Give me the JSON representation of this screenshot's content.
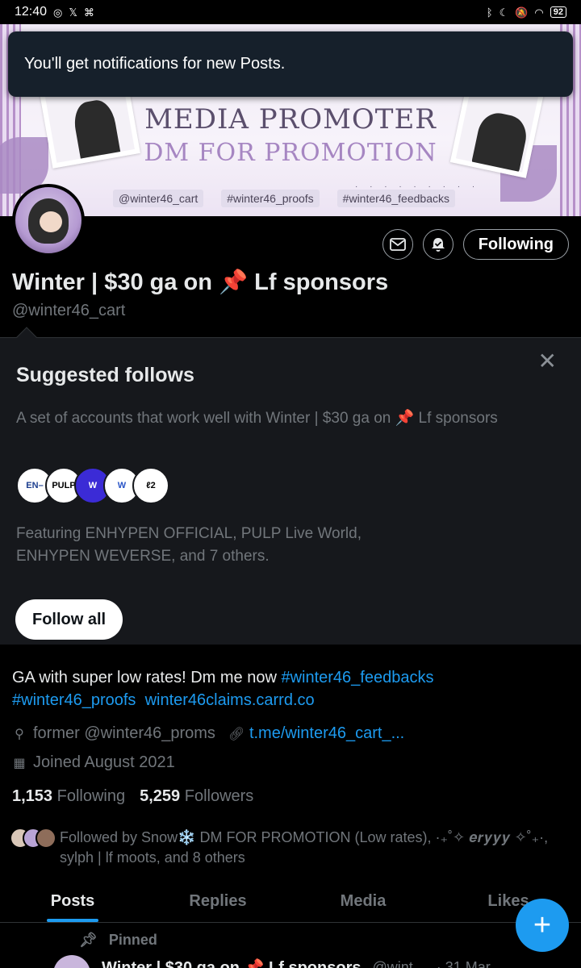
{
  "status_bar": {
    "time": "12:40",
    "battery": "92"
  },
  "toast": {
    "message": "You'll get notifications for new Posts."
  },
  "banner": {
    "line1": "MEDIA PROMOTER",
    "line2": "DM FOR PROMOTION",
    "tags": [
      "@winter46_cart",
      "#winter46_proofs",
      "#winter46_feedbacks"
    ]
  },
  "profile": {
    "name": "Winter | $30 ga on 📌 Lf sponsors",
    "handle": "@winter46_cart",
    "following_button": "Following",
    "bio_text": "GA with super low rates! Dm me now ",
    "bio_tag1": "#winter46_feedbacks",
    "bio_tag2": "#winter46_proofs",
    "bio_link": "winter46claims.carrd.co",
    "location": "former @winter46_proms",
    "website": "t.me/winter46_cart_...",
    "joined": "Joined August 2021",
    "following_count": "1,153",
    "following_label": "Following",
    "followers_count": "5,259",
    "followers_label": "Followers",
    "followed_by": "Followed by Snow❄️ DM FOR PROMOTION (Low rates), ·₊˚✧ 𝒆𝒓𝒚𝒚𝒚 ✧˚₊·, sylph | lf moots, and 8 others"
  },
  "suggested": {
    "title": "Suggested follows",
    "description": "A set of accounts that work well with Winter | $30 ga on 📌 Lf sponsors",
    "featuring": "Featuring ENHYPEN OFFICIAL, PULP Live World, ENHYPEN WEVERSE, and 7 others.",
    "follow_all": "Follow all"
  },
  "tabs": [
    "Posts",
    "Replies",
    "Media",
    "Likes"
  ],
  "pinned_post": {
    "pinned_label": "Pinned",
    "author": "Winter | $30 ga on 📌 Lf sponsors",
    "handle": "@wint...",
    "date": "· 31 Mar"
  },
  "icons": {
    "message": "envelope-icon",
    "notifications": "bell-check-icon",
    "close": "close-icon",
    "location": "location-pin-icon",
    "link": "link-icon",
    "calendar": "calendar-icon",
    "pin": "pin-icon",
    "compose": "plus-icon"
  },
  "colors": {
    "accent": "#1d9bf0",
    "background": "#000000",
    "muted": "#71767b"
  }
}
